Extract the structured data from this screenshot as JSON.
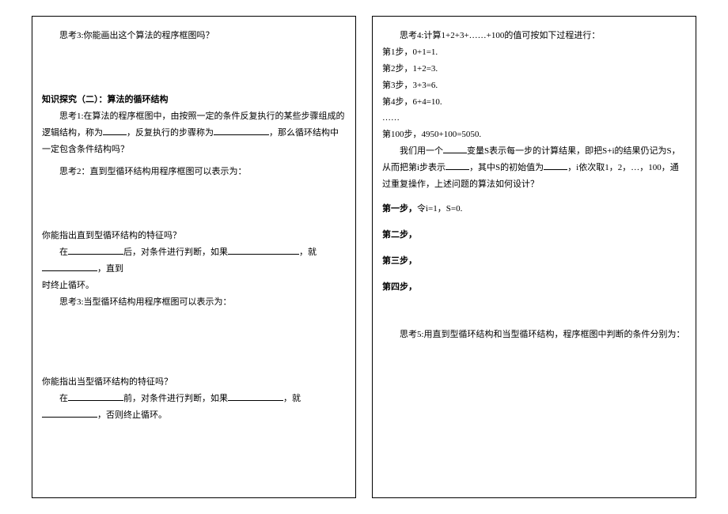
{
  "left": {
    "think3": "思考3:你能画出这个算法的程序框图吗？",
    "section_title": "知识探究（二）：算法的循环结构",
    "think1_a": "思考1:在算法的程序框图中，由按照一定的条件反复执行的某些步骤组成的逻辑结构，称为",
    "think1_b": "，反复执行的步骤称为",
    "think1_c": "，那么循环结构中一定包含条件结构吗？",
    "think2": "思考2：直到型循环结构用程序框图可以表示为：",
    "feature1_q": "你能指出直到型循环结构的特征吗？",
    "feature1_a": "在",
    "feature1_b": "后，对条件进行判断，如果",
    "feature1_c": "，就",
    "feature1_d": "，直到",
    "feature1_e": "时终止循环。",
    "think3b": "思考3:当型循环结构用程序框图可以表示为：",
    "feature2_q": "你能指出当型循环结构的特征吗？",
    "feature2_a": "在",
    "feature2_b": "前，对条件进行判断，如果",
    "feature2_c": "，就",
    "feature2_d": "，否则终止循环。"
  },
  "right": {
    "think4": "思考4:计算1+2+3+……+100的值可按如下过程进行：",
    "step1": "第1步，0+1=1.",
    "step2": "第2步，1+2=3.",
    "step3": "第3步，3+3=6.",
    "step4": "第4步，6+4=10.",
    "dots": "……",
    "step100": "第100步，4950+100=5050.",
    "desc_a": "我们用一个",
    "desc_b": "变量S表示每一步的计算结果，即把S+i的结果仍记为S，从而把第i步表示",
    "desc_c": "，其中S的初始值为",
    "desc_d": "，i依次取1，2，…，100，通过重复操作，上述问题的算法如何设计？",
    "algo_step1_label": "第一步，",
    "algo_step1_text": "令i=1，S=0.",
    "algo_step2_label": "第二步，",
    "algo_step3_label": "第三步，",
    "algo_step4_label": "第四步，",
    "think5": "思考5:用直到型循环结构和当型循环结构，程序框图中判断的条件分别为："
  }
}
